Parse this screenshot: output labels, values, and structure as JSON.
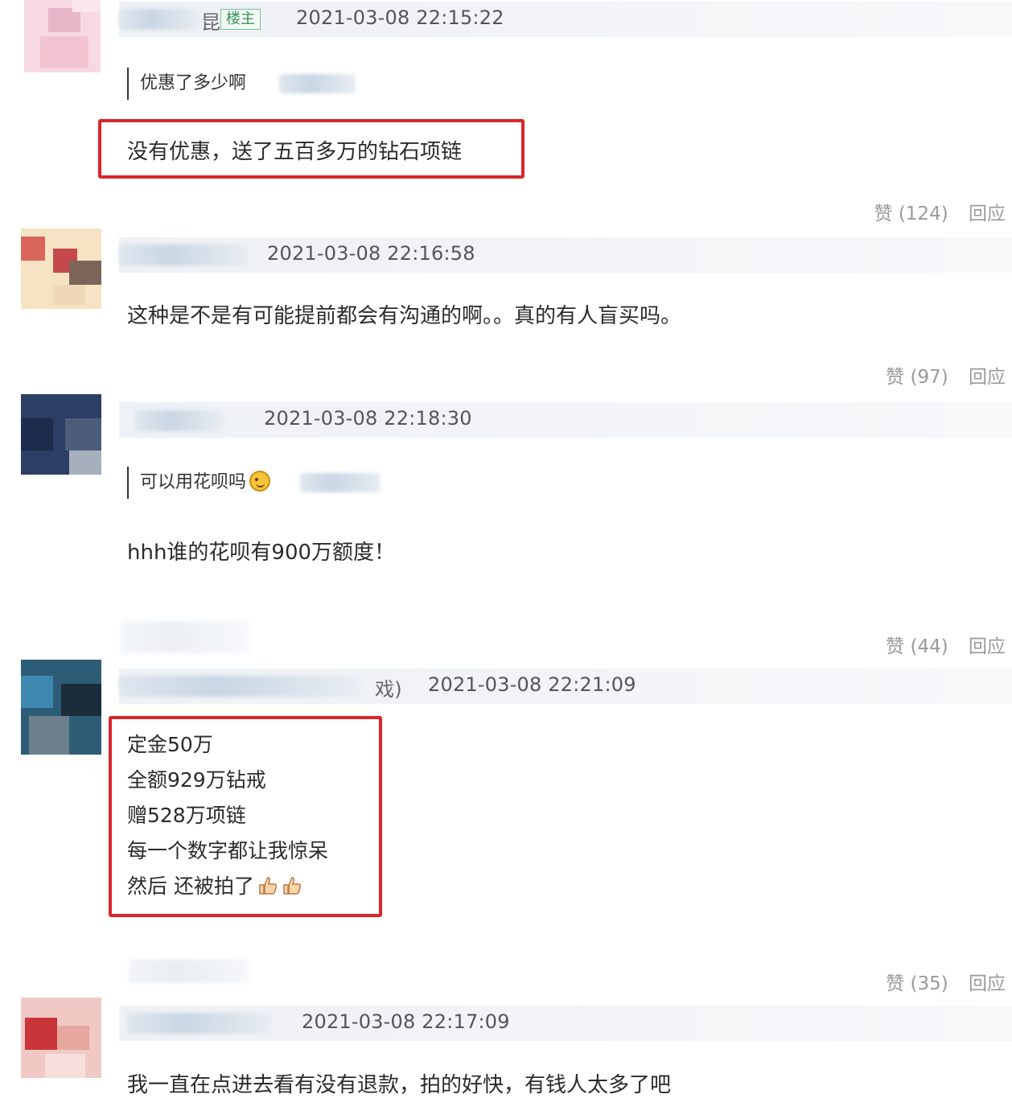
{
  "comments": [
    {
      "timestamp": "2021-03-08 22:15:22",
      "badge": "楼主",
      "name_fragment": "昆",
      "quote": "优惠了多少啊",
      "content": "没有优惠，送了五百多万的钻石项链",
      "likes": "赞 (124)",
      "reply": "回应"
    },
    {
      "timestamp": "2021-03-08 22:16:58",
      "content": "这种是不是有可能提前都会有沟通的啊。。真的有人盲买吗。",
      "likes": "赞 (97)",
      "reply": "回应"
    },
    {
      "timestamp": "2021-03-08 22:18:30",
      "quote": "可以用花呗吗",
      "content": "hhh谁的花呗有900万额度！",
      "likes": "赞 (44)",
      "reply": "回应"
    },
    {
      "timestamp": "2021-03-08 22:21:09",
      "name_fragment": "戏)",
      "content_lines": [
        "定金50万",
        "全额929万钻戒",
        "赠528万项链",
        "每一个数字都让我惊呆",
        "然后 还被拍了"
      ],
      "likes": "赞 (35)",
      "reply": "回应"
    },
    {
      "timestamp": "2021-03-08 22:17:09",
      "content": "我一直在点进去看有没有退款，拍的好快，有钱人太多了吧"
    }
  ],
  "colors": {
    "highlight_border": "#d9262a",
    "meta_bar": "#eef1f5",
    "action_text": "#9a9a9a"
  }
}
